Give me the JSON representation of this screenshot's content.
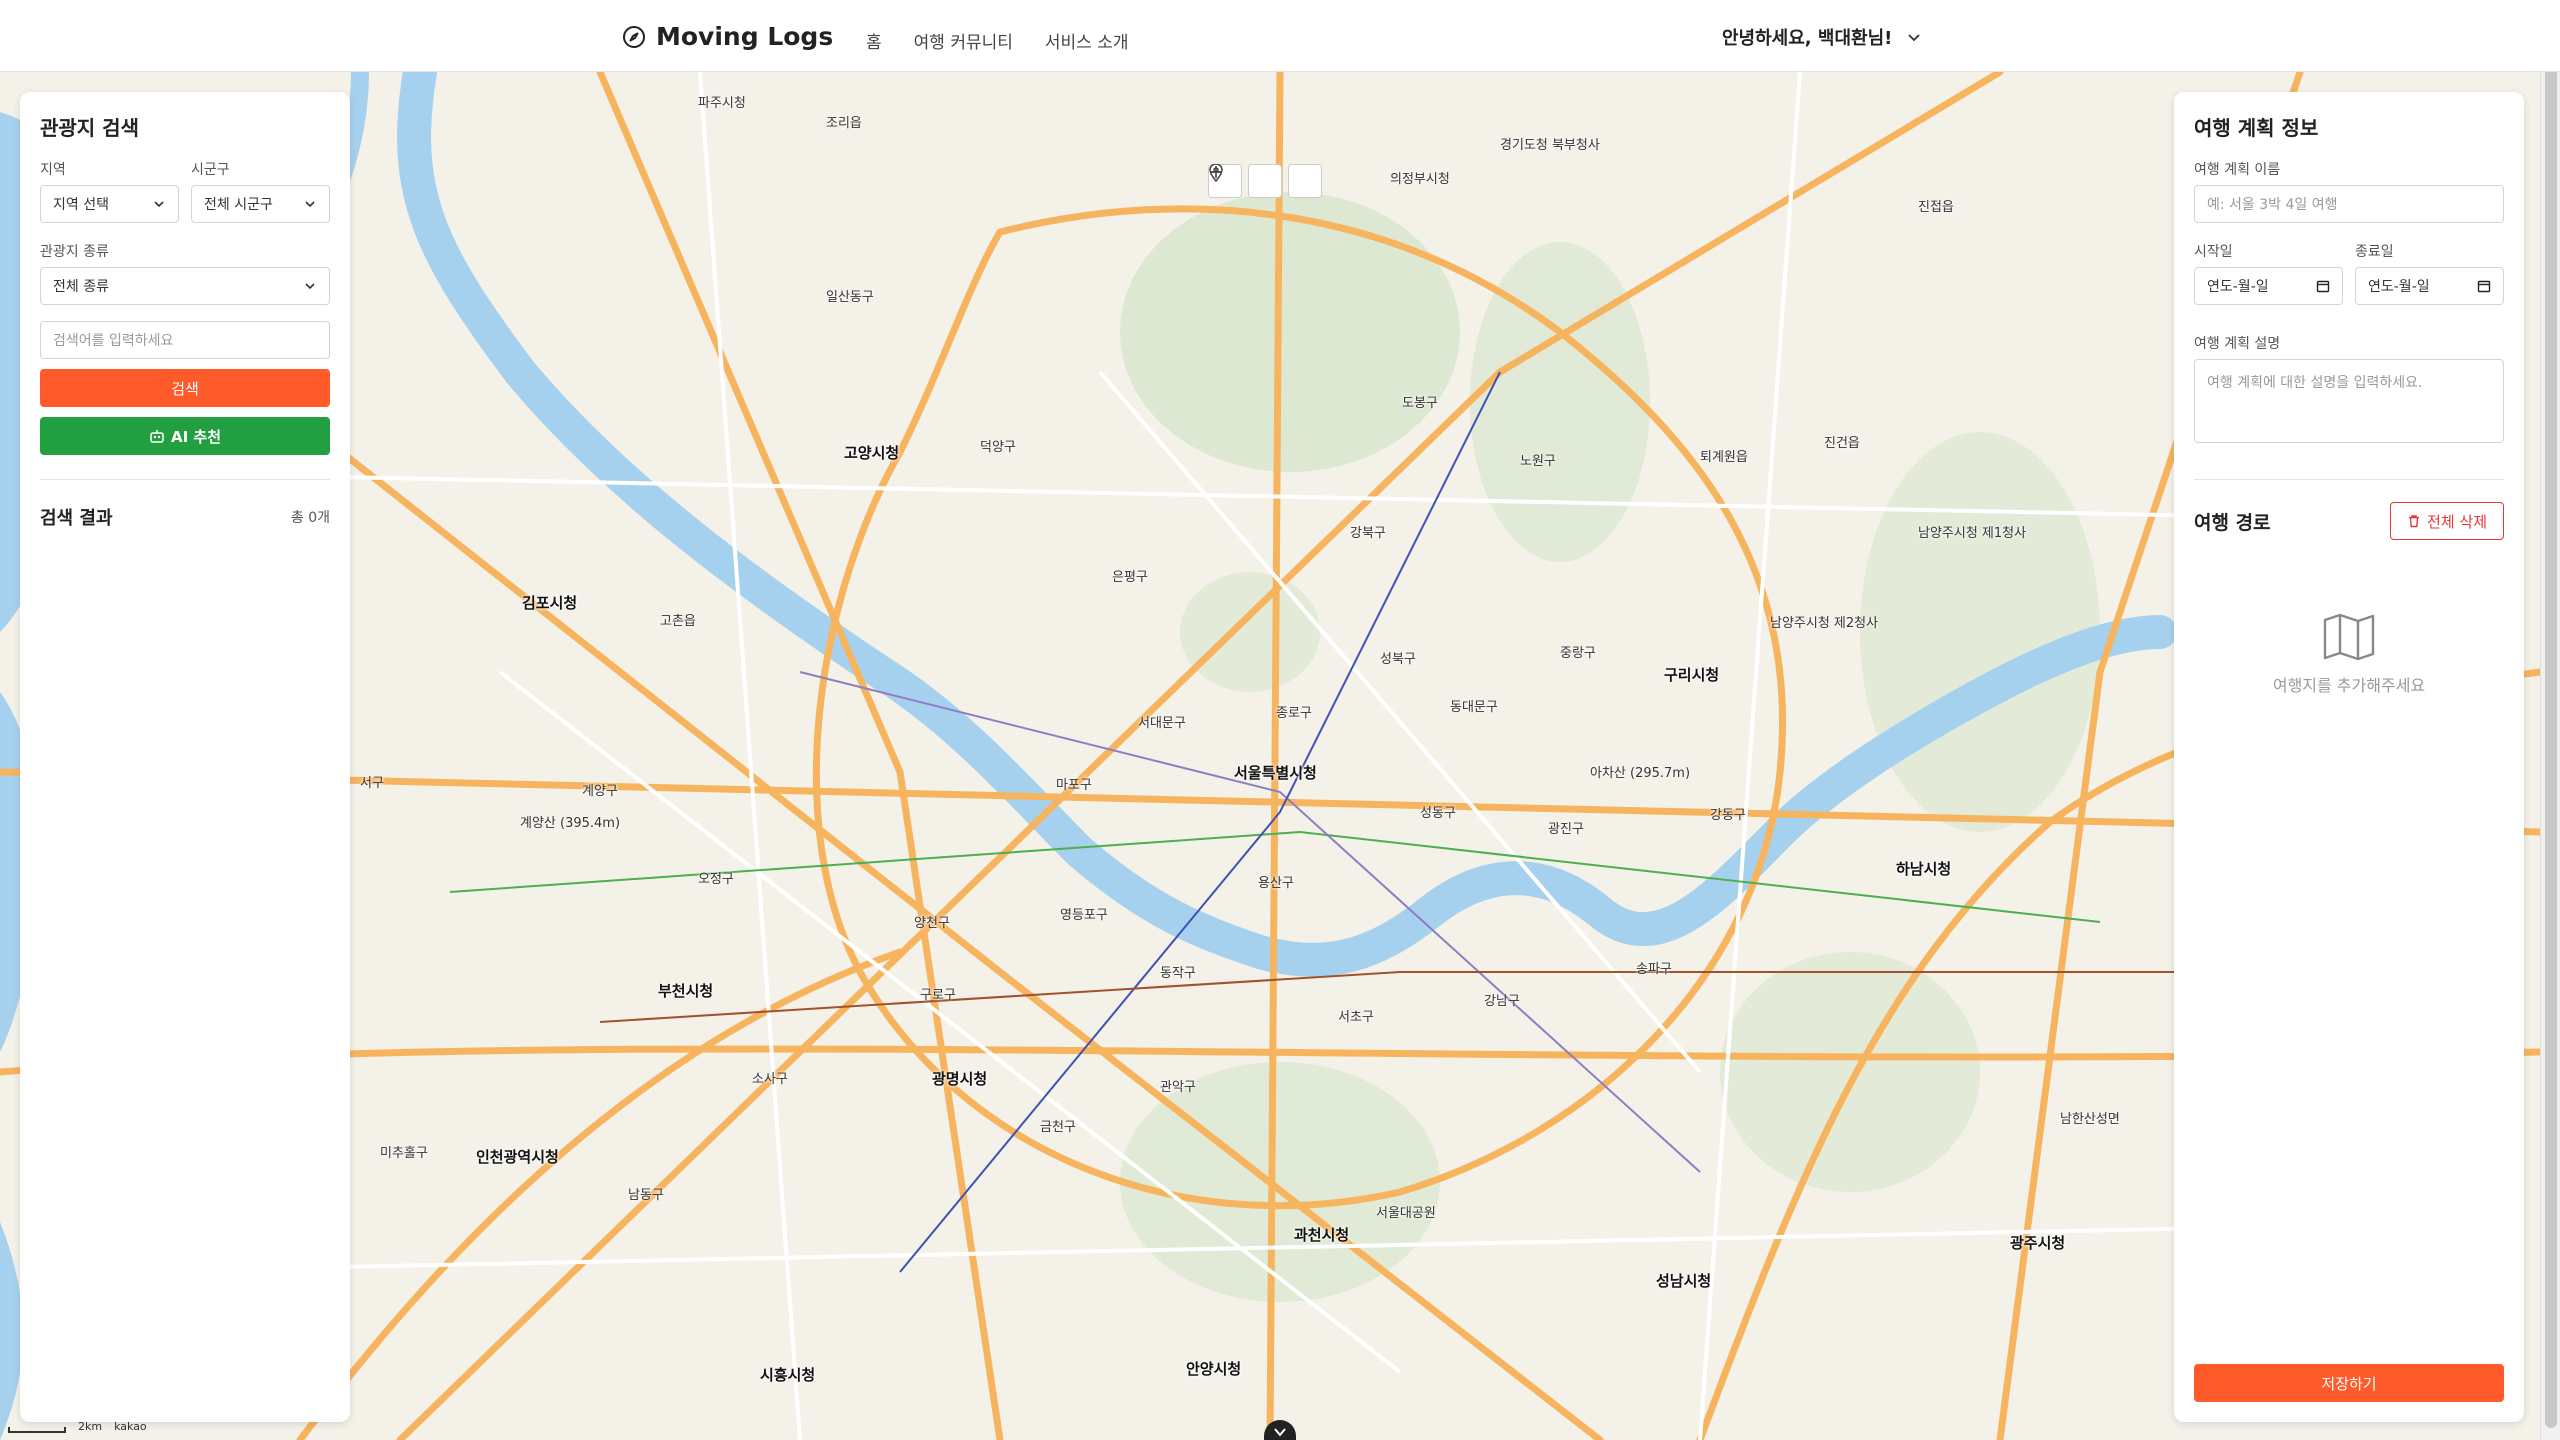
{
  "header": {
    "logo_text": "Moving Logs",
    "nav": [
      "홈",
      "여행 커뮤니티",
      "서비스 소개"
    ],
    "user_greeting": "안녕하세요, 백대환님!"
  },
  "map": {
    "labels": [
      "파주시청",
      "조리읍",
      "의정부시청",
      "경기도청 북부청사",
      "진접읍",
      "일산동구",
      "고양시청",
      "덕양구",
      "도봉구",
      "노원구",
      "퇴계원읍",
      "진건읍",
      "남양주시청 제1청사",
      "김포시청",
      "고촌읍",
      "강북구",
      "은평구",
      "성북구",
      "남양주시청 제2청사",
      "구리시청",
      "중랑구",
      "동대문구",
      "서대문구",
      "종로구",
      "서울특별시청",
      "마포구",
      "성동구",
      "광진구",
      "강동구",
      "하남시청",
      "용산구",
      "계양구",
      "인천광역시청",
      "부천시청",
      "오정구",
      "양천구",
      "영등포구",
      "동작구",
      "서초구",
      "강남구",
      "송파구",
      "구로구",
      "금천구",
      "광명시청",
      "관악구",
      "과천시청",
      "남동구",
      "미추홀구",
      "소사구",
      "안양시청",
      "성남시청",
      "남한산성면",
      "광주시청",
      "시흥시청",
      "서구",
      "계양산 (395.4m)",
      "아차산 (295.7m)",
      "서울대공원"
    ],
    "scale_label": "2km",
    "provider": "kakao"
  },
  "search_panel": {
    "title": "관광지 검색",
    "region_label": "지역",
    "region_value": "지역 선택",
    "district_label": "시군구",
    "district_value": "전체 시군구",
    "type_label": "관광지 종류",
    "type_value": "전체 종류",
    "keyword_placeholder": "검색어를 입력하세요",
    "search_button": "검색",
    "ai_button": "AI 추천",
    "results_title": "검색 결과",
    "results_count": "총 0개"
  },
  "plan_panel": {
    "title": "여행 계획 정보",
    "name_label": "여행 계획 이름",
    "name_placeholder": "예: 서울 3박 4일 여행",
    "start_label": "시작일",
    "start_placeholder": "연도-월-일",
    "end_label": "종료일",
    "end_placeholder": "연도-월-일",
    "desc_label": "여행 계획 설명",
    "desc_placeholder": "여행 계획에 대한 설명을 입력하세요.",
    "route_title": "여행 경로",
    "delete_all_button": "전체 삭제",
    "empty_route_text": "여행지를 추가해주세요",
    "save_button": "저장하기"
  },
  "colors": {
    "accent_orange": "#ff5a2a",
    "ai_green": "#22a041",
    "danger_red": "#e53935",
    "river": "#a6d1ee",
    "road": "#f7b45f"
  }
}
